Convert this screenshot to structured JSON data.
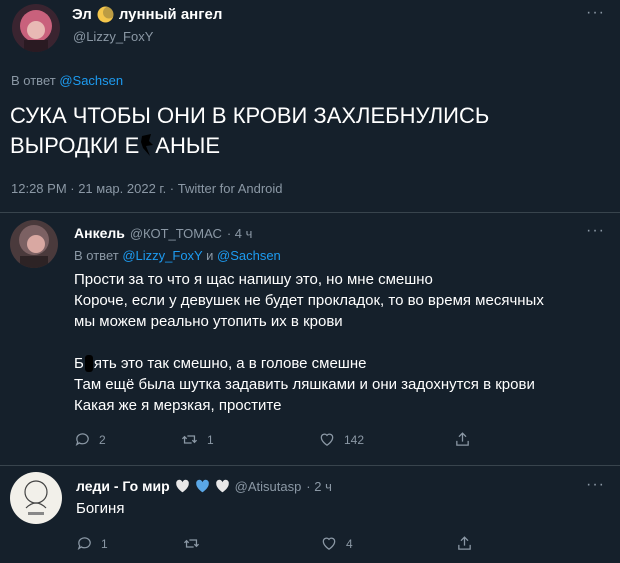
{
  "main_tweet": {
    "display_name": "Эл",
    "name_suffix": "лунный ангел",
    "handle": "@Lizzy_FoxY",
    "reply_to_prefix": "В ответ",
    "reply_to_handle": "@Sachsen",
    "text_line1": "СУКА ЧТОБЫ ОНИ В КРОВИ ЗАХЛЕБНУЛИСЬ",
    "text_line2_start": "ВЫРОДКИ Е",
    "text_line2_end": "АНЫЕ",
    "meta": "12:28 PM · 21 мар. 2022 г. · Twitter for Android"
  },
  "reply1": {
    "display_name": "Анкель",
    "handle": "@КОТ_ТОМАС",
    "time": "· 4 ч",
    "reply_to_prefix": "В ответ",
    "reply_to_handle1": "@Lizzy_FoxY",
    "reply_to_and": "и",
    "reply_to_handle2": "@Sachsen",
    "line1": "Прости за то что я щас напишу это, но мне смешно",
    "line2": "Короче, если у девушек не будет прокладок, то во время месячных",
    "line3": "мы можем реально утопить их в крови",
    "line4_start": "Б",
    "line4_end": "ять это так смешно, а в голове смешне",
    "line5": "Там ещё была шутка задавить ляшками и они задохнутся в крови",
    "line6": "Какая же я мерзкая, простите",
    "replies": "2",
    "retweets": "1",
    "likes": "142"
  },
  "reply2": {
    "display_name": "леди - Го мир",
    "handle": "@Atisutasp",
    "time": "· 2 ч",
    "text": "Богиня",
    "replies": "1",
    "retweets": "",
    "likes": "4"
  },
  "more_glyph": "···",
  "colors": {
    "background": "#15202b",
    "muted": "#8b98a5",
    "link": "#1d9bf0",
    "divider": "#38444d"
  }
}
